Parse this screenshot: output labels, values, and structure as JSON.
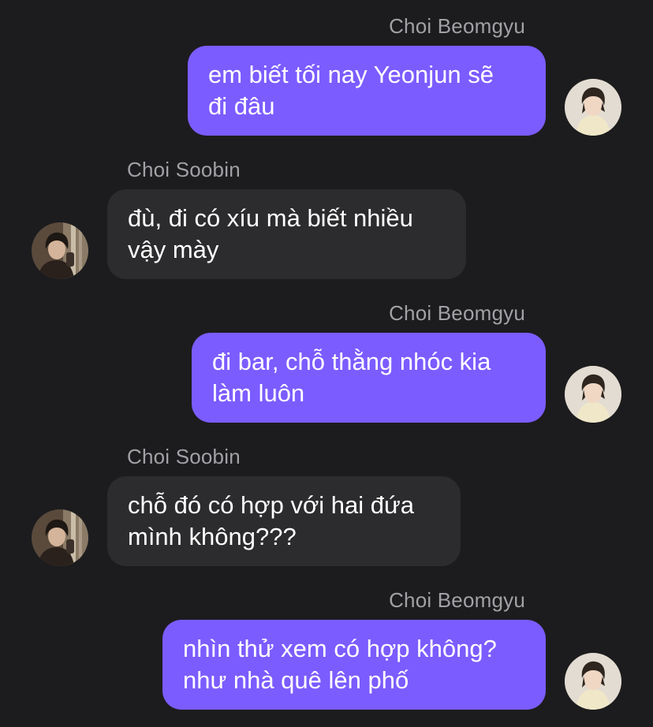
{
  "messages": [
    {
      "direction": "outgoing",
      "sender": "Choi Beomgyu",
      "lines": [
        "em biết tối nay Yeonjun sẽ",
        "đi đâu"
      ]
    },
    {
      "direction": "incoming",
      "sender": "Choi Soobin",
      "lines": [
        "đù, đi có xíu mà biết nhiều",
        "vậy mày"
      ]
    },
    {
      "direction": "outgoing",
      "sender": "Choi Beomgyu",
      "lines": [
        "đi bar, chỗ thằng nhóc kia",
        "làm luôn"
      ]
    },
    {
      "direction": "incoming",
      "sender": "Choi Soobin",
      "lines": [
        "chỗ đó có hợp với hai đứa",
        "mình không???"
      ]
    },
    {
      "direction": "outgoing",
      "sender": "Choi Beomgyu",
      "lines": [
        "nhìn thử xem có hợp không?",
        "như nhà quê lên phố"
      ]
    }
  ],
  "colors": {
    "background": "#1c1c1e",
    "outgoing_bubble": "#7b5cff",
    "incoming_bubble": "#2c2c2e",
    "sender_name": "#a1a1a6",
    "message_text": "#ffffff"
  },
  "icons": {
    "outgoing_avatar": "beomgyu-avatar-icon",
    "incoming_avatar": "soobin-avatar-icon"
  }
}
